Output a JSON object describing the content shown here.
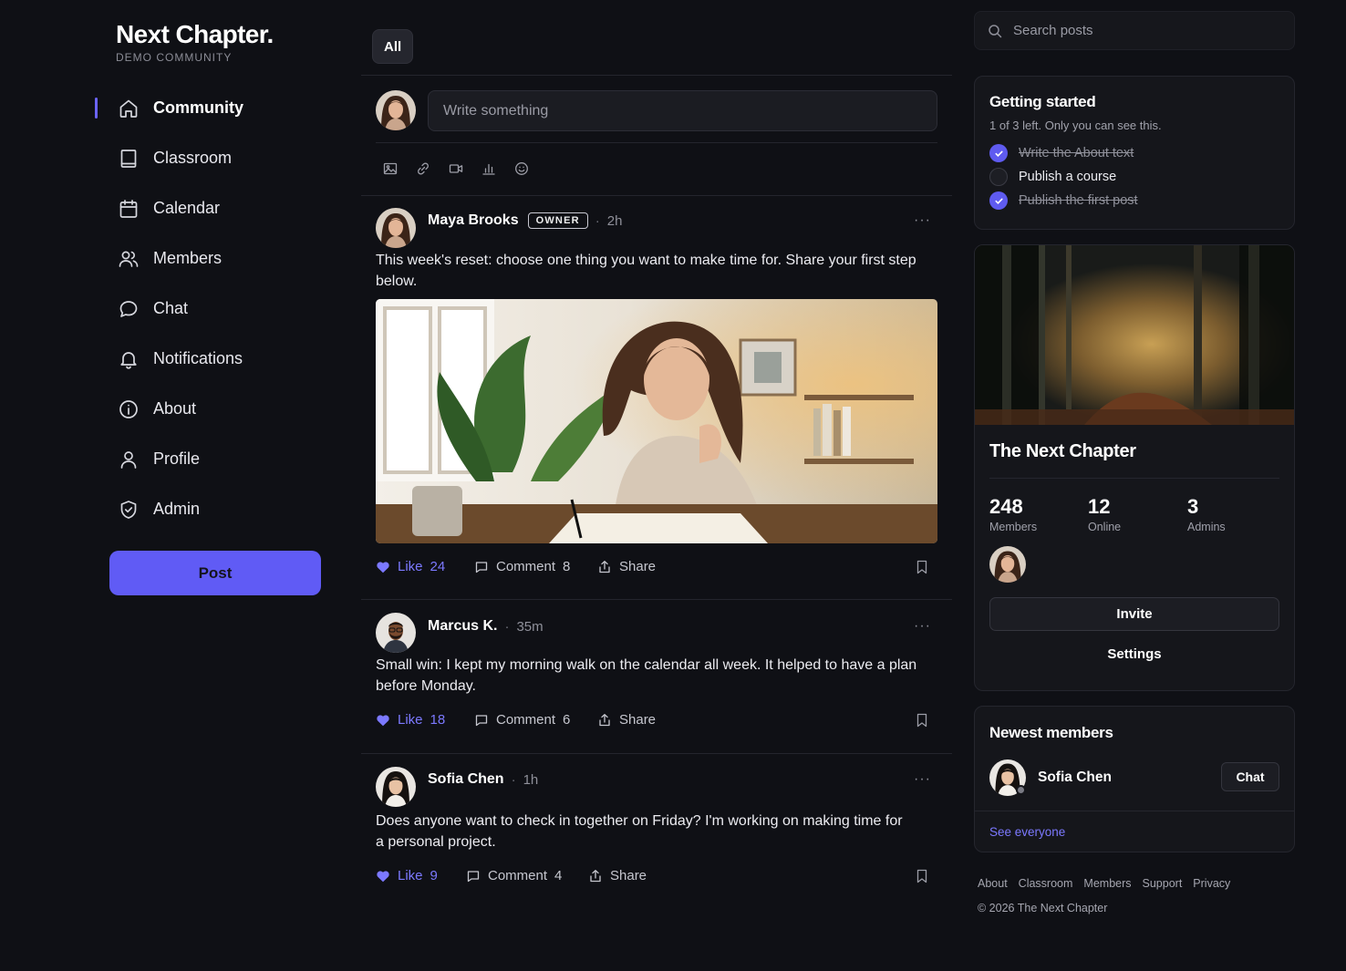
{
  "brand": {
    "title": "Next Chapter.",
    "subtitle": "DEMO COMMUNITY"
  },
  "nav": {
    "items": [
      {
        "label": "Community",
        "icon": "home-icon",
        "active": true
      },
      {
        "label": "Classroom",
        "icon": "book-icon"
      },
      {
        "label": "Calendar",
        "icon": "calendar-icon"
      },
      {
        "label": "Members",
        "icon": "users-icon"
      },
      {
        "label": "Chat",
        "icon": "chat-bubble-icon"
      },
      {
        "label": "Notifications",
        "icon": "bell-icon"
      },
      {
        "label": "About",
        "icon": "info-icon"
      },
      {
        "label": "Profile",
        "icon": "user-icon"
      },
      {
        "label": "Admin",
        "icon": "shield-icon"
      }
    ],
    "post_button": "Post"
  },
  "feed": {
    "filter_tab": "All",
    "composer": {
      "placeholder": "Write something",
      "tools": [
        "image-icon",
        "link-icon",
        "video-icon",
        "poll-icon",
        "emoji-icon"
      ]
    },
    "posts": [
      {
        "author": "Maya Brooks",
        "badge": "OWNER",
        "time": "2h",
        "text": "This week's reset: choose one thing you want to make time for. Share your first step below.",
        "has_image": true,
        "like_label": "Like",
        "likes": "24",
        "comment_label": "Comment",
        "comments": "8",
        "share_label": "Share"
      },
      {
        "author": "Marcus K.",
        "time": "35m",
        "text": "Small win: I kept my morning walk on the calendar all week. It helped to have a plan before Monday.",
        "like_label": "Like",
        "likes": "18",
        "comment_label": "Comment",
        "comments": "6",
        "share_label": "Share"
      },
      {
        "author": "Sofia Chen",
        "time": "1h",
        "text": "Does anyone want to check in together on Friday? I'm working on making time for a personal project.",
        "like_label": "Like",
        "likes": "9",
        "comment_label": "Comment",
        "comments": "4",
        "share_label": "Share"
      }
    ]
  },
  "search": {
    "placeholder": "Search posts"
  },
  "getting_started": {
    "title": "Getting started",
    "subtitle": "1 of 3 left. Only you can see this.",
    "tasks": [
      {
        "label": "Write the About text",
        "done": true
      },
      {
        "label": "Publish a course",
        "done": false
      },
      {
        "label": "Publish the first post",
        "done": true
      }
    ]
  },
  "community_card": {
    "name": "The Next Chapter",
    "stats": [
      {
        "value": "248",
        "label": "Members"
      },
      {
        "value": "12",
        "label": "Online"
      },
      {
        "value": "3",
        "label": "Admins"
      }
    ],
    "invite_label": "Invite",
    "settings_label": "Settings"
  },
  "newest_members": {
    "title": "Newest members",
    "members": [
      {
        "name": "Sofia Chen",
        "action": "Chat"
      }
    ],
    "see_all": "See everyone"
  },
  "footer": {
    "links": [
      "About",
      "Classroom",
      "Members",
      "Support",
      "Privacy"
    ],
    "copyright": "© 2026 The Next Chapter"
  },
  "colors": {
    "accent": "#605bf5",
    "like": "#7c79ff",
    "background": "#0f1015",
    "card": "#15161b"
  }
}
